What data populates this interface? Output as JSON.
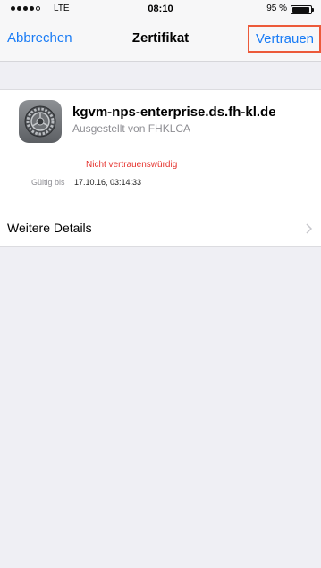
{
  "status_bar": {
    "carrier": "LTE",
    "time": "08:10",
    "battery": "95 %",
    "battery_level": 0.95
  },
  "nav": {
    "cancel": "Abbrechen",
    "title": "Zertifikat",
    "trust": "Vertrauen",
    "highlight_color": "#ec5a3a"
  },
  "certificate": {
    "name": "kgvm-nps-enterprise.ds.fh-kl.de",
    "issuer": "Ausgestellt von FHKLCA",
    "status": "Nicht vertrauenswürdig",
    "valid_label": "Gültig bis",
    "valid_value": "17.10.16, 03:14:33"
  },
  "details": {
    "label": "Weitere Details"
  },
  "colors": {
    "tint": "#1a7cf5",
    "warning": "#e5322d",
    "background": "#efeff4"
  }
}
